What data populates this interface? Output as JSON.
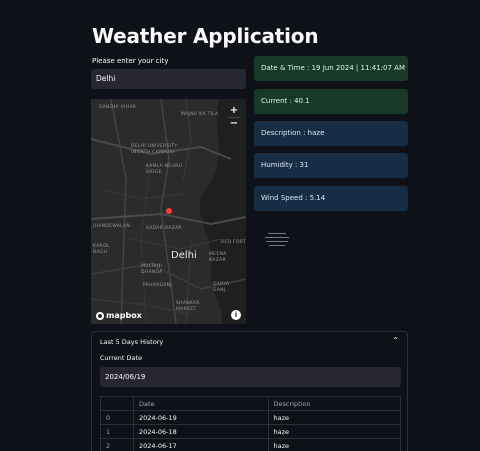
{
  "app": {
    "title": "Weather Application"
  },
  "city": {
    "label": "Please enter your city",
    "value": "Delhi"
  },
  "map": {
    "city_label": "Delhi",
    "zoom_in": "+",
    "zoom_out": "−",
    "attribution_logo": "mapbox",
    "info": "i",
    "labels": [
      {
        "text": "Gandhi Vihar"
      },
      {
        "text": "Majnu Ka Tila"
      },
      {
        "text": "Delhi University (North Campus)"
      },
      {
        "text": "Kamla Nehru Ridge"
      },
      {
        "text": "Sadar Bazar"
      },
      {
        "text": "Multani Dhanda"
      },
      {
        "text": "Paharganj"
      },
      {
        "text": "Shankar Market"
      },
      {
        "text": "Red Fort"
      },
      {
        "text": "Meena Bazar"
      },
      {
        "text": "Darya Ganj"
      },
      {
        "text": "Karol Bagh"
      },
      {
        "text": "Jhandewalan"
      }
    ],
    "marker_color": "#ff3b3b"
  },
  "cards": {
    "datetime": "Date & Time : 19 Jun 2024 | 11:41:07 AM",
    "current": "Current : 40.1",
    "description": "Description : haze",
    "humidity": "Humidity : 31",
    "wind": "Wind Speed : 5.14"
  },
  "history": {
    "title": "Last 5 Days History",
    "date_label": "Current Date",
    "date_value": "2024/06/19",
    "columns": [
      "",
      "Date",
      "Description"
    ],
    "rows": [
      {
        "idx": "0",
        "date": "2024-06-19",
        "desc": "haze"
      },
      {
        "idx": "1",
        "date": "2024-06-18",
        "desc": "haze"
      },
      {
        "idx": "2",
        "date": "2024-06-17",
        "desc": "haze"
      }
    ]
  }
}
